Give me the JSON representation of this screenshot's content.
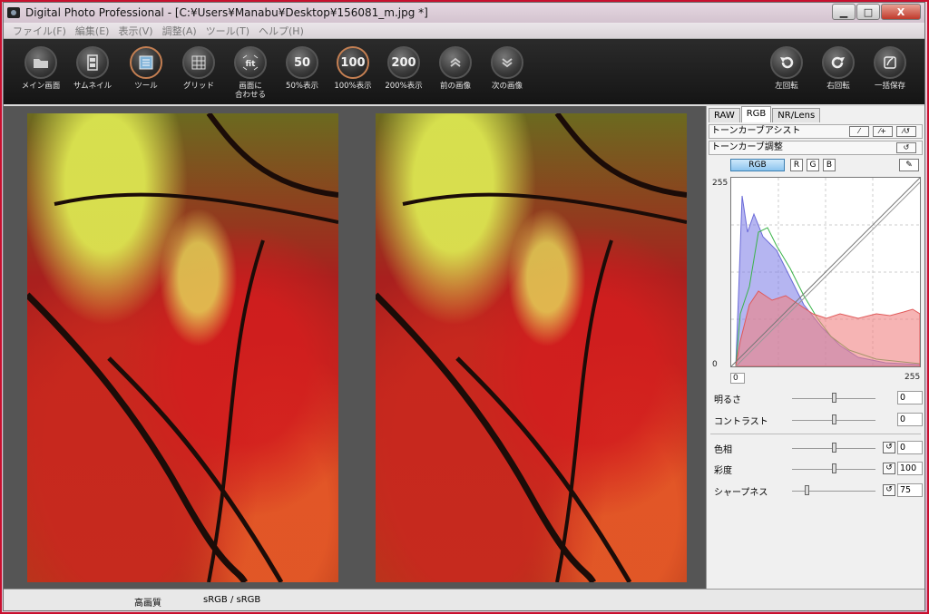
{
  "window": {
    "title": "Digital Photo Professional - [C:¥Users¥Manabu¥Desktop¥156081_m.jpg *]",
    "controls": [
      "▁",
      "□",
      "X"
    ]
  },
  "menu": [
    "ファイル(F)",
    "編集(E)",
    "表示(V)",
    "調整(A)",
    "ツール(T)",
    "ヘルプ(H)"
  ],
  "toolbar": {
    "tools": [
      {
        "label": "メイン画面",
        "icon": "folder-icon"
      },
      {
        "label": "サムネイル",
        "icon": "thumbnail-icon"
      },
      {
        "label": "ツール",
        "icon": "tool-palette-icon"
      },
      {
        "label": "グリッド",
        "icon": "grid-icon"
      },
      {
        "label": "画面に\n合わせる",
        "icon": "fit-to-screen-icon"
      },
      {
        "label": "50%表示",
        "glyph": "50"
      },
      {
        "label": "100%表示",
        "glyph": "100"
      },
      {
        "label": "200%表示",
        "glyph": "200"
      },
      {
        "label": "前の画像",
        "icon": "chevron-up-icon"
      },
      {
        "label": "次の画像",
        "icon": "chevron-down-icon"
      },
      {
        "label": "左回転",
        "icon": "rotate-left-icon"
      },
      {
        "label": "右回転",
        "icon": "rotate-right-icon"
      },
      {
        "label": "一括保存",
        "icon": "batch-save-icon"
      }
    ]
  },
  "panel": {
    "tabs": [
      "RAW",
      "RGB",
      "NR/Lens"
    ],
    "active_tab": "RGB",
    "tone_curve_assist": "トーンカーブアシスト",
    "tone_curve_adjust": "トーンカーブ調整",
    "channels": [
      "RGB",
      "R",
      "G",
      "B"
    ],
    "graph": {
      "y_max": "255",
      "y_min": "0",
      "x_min": "0",
      "x_max": "255"
    },
    "sliders_top": [
      {
        "name": "明るさ",
        "value": "0",
        "position": 0.5
      },
      {
        "name": "コントラスト",
        "value": "0",
        "position": 0.5
      }
    ],
    "sliders_bottom": [
      {
        "name": "色相",
        "value": "0",
        "position": 0.5
      },
      {
        "name": "彩度",
        "value": "100",
        "position": 0.5
      },
      {
        "name": "シャープネス",
        "value": "75",
        "position": 0.15
      }
    ]
  },
  "status": {
    "quality": "高画質",
    "color_space": "sRGB / sRGB"
  },
  "colors": {
    "toolbar_bg": "#1a1a1a",
    "active_channel": "#8cc4ef",
    "window_frame": "#c8102e"
  }
}
